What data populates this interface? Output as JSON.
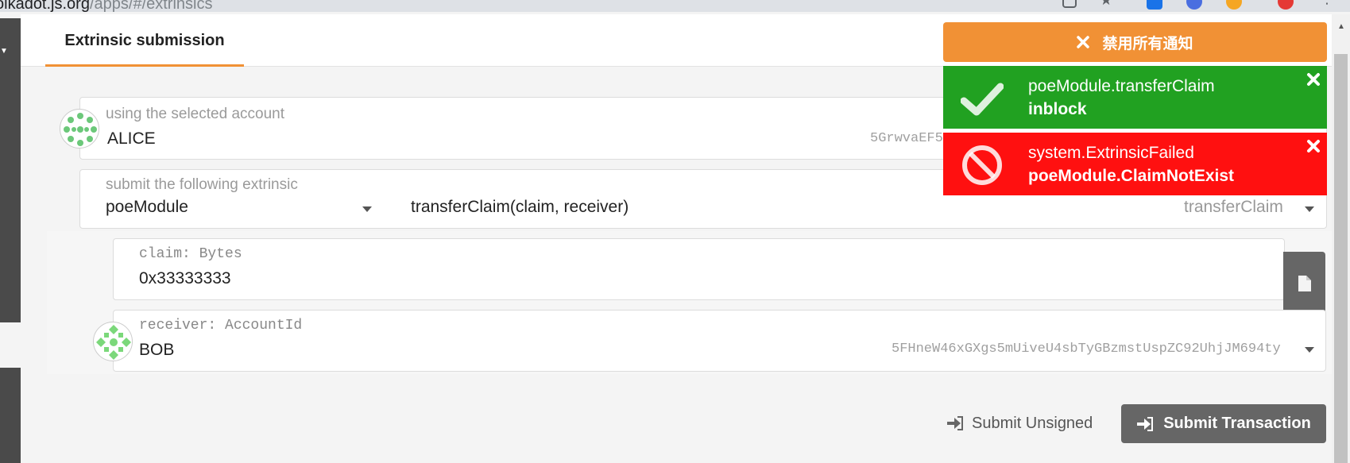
{
  "browser": {
    "url_host": "olkadot.js.org",
    "url_path": "/apps/#/extrinsics"
  },
  "tabs": [
    {
      "label": "Extrinsic submission"
    }
  ],
  "account": {
    "label": "using the selected account",
    "name": "ALICE",
    "address_visible": "5GrwvaEF5"
  },
  "extrinsic": {
    "label": "submit the following extrinsic",
    "module": "poeModule",
    "call_signature": "transferClaim(claim, receiver)",
    "call_name": "transferClaim"
  },
  "params": {
    "claim": {
      "label": "claim: Bytes",
      "value": "0x33333333"
    },
    "receiver": {
      "label": "receiver: AccountId",
      "name": "BOB",
      "address": "5FHneW46xGXgs5mUiveU4sbTyGBzmstUspZC92UhjJM694ty"
    }
  },
  "actions": {
    "submit_unsigned": "Submit Unsigned",
    "submit_transaction": "Submit Transaction"
  },
  "notifications": {
    "disable_all": "禁用所有通知",
    "items": [
      {
        "status": "success",
        "title": "poeModule.transferClaim",
        "detail": "inblock"
      },
      {
        "status": "error",
        "title": "system.ExtrinsicFailed",
        "detail": "poeModule.ClaimNotExist"
      }
    ]
  },
  "colors": {
    "accent": "#f19135",
    "success": "#21a121",
    "error": "#ff1010",
    "button": "#666666"
  }
}
